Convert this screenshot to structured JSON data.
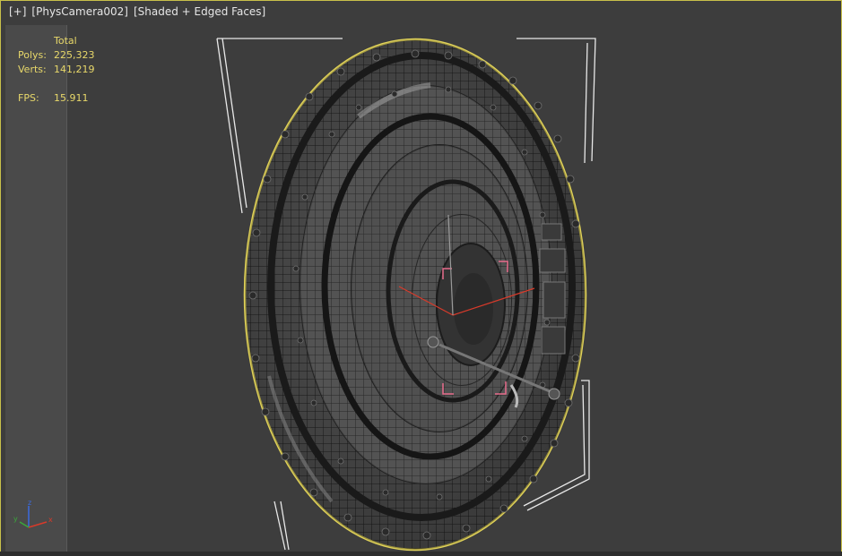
{
  "viewport": {
    "menu_label": "[+]",
    "camera_label": "[PhysCamera002]",
    "shading_label": "[Shaded + Edged Faces]"
  },
  "stats": {
    "header": "Total",
    "polys_label": "Polys:",
    "polys_value": "225,323",
    "verts_label": "Verts:",
    "verts_value": "141,219",
    "fps_label": "FPS:",
    "fps_value": "15.911"
  },
  "gizmo": {
    "x_label": "x",
    "y_label": "y",
    "z_label": "z"
  },
  "colors": {
    "viewport_border": "#c8c04a",
    "stats_text": "#e8d86a",
    "selection_outline": "#e0d25a",
    "transform_gizmo": "#d83a2a"
  }
}
